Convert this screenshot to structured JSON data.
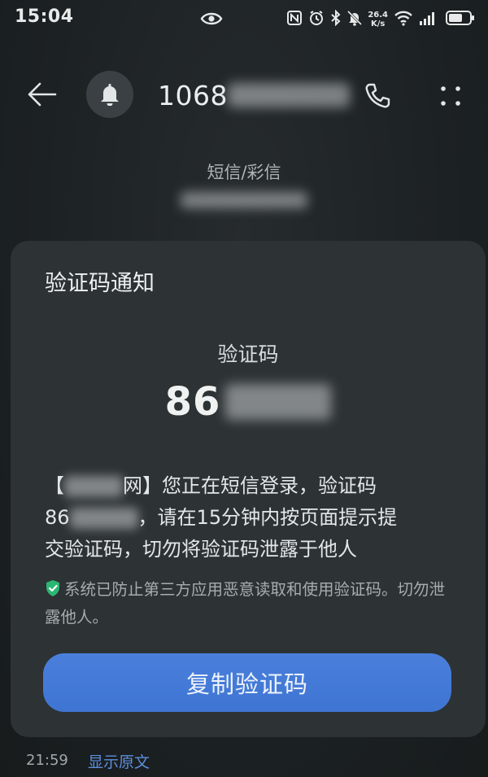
{
  "status_bar": {
    "time": "15:04",
    "net_speed_value": "26.4",
    "net_speed_unit": "K/s"
  },
  "header": {
    "sender_prefix": "1068",
    "back_icon": "arrow-left-icon",
    "avatar_icon": "bell-icon",
    "call_icon": "phone-icon",
    "more_icon": "more-dots-icon"
  },
  "channel_label": "短信/彩信",
  "card": {
    "title": "验证码通知",
    "code_label": "验证码",
    "code_prefix": "86",
    "body": {
      "bracket_open": "【",
      "bracket_close": "网】您正在短信登录，验证码",
      "code_prefix": "86",
      "line2_rest": "，请在15分钟内按页面提示提",
      "line3": "交验证码，切勿将验证码泄露于他人"
    },
    "security_note": "系统已防止第三方应用恶意读取和使用验证码。切勿泄露他人。",
    "copy_button": "复制验证码"
  },
  "footer": {
    "time": "21:59",
    "show_original": "显示原文"
  },
  "colors": {
    "background": "#1d2224",
    "card": "#2d3234",
    "accent": "#4a80dc",
    "shield": "#2bb673"
  }
}
